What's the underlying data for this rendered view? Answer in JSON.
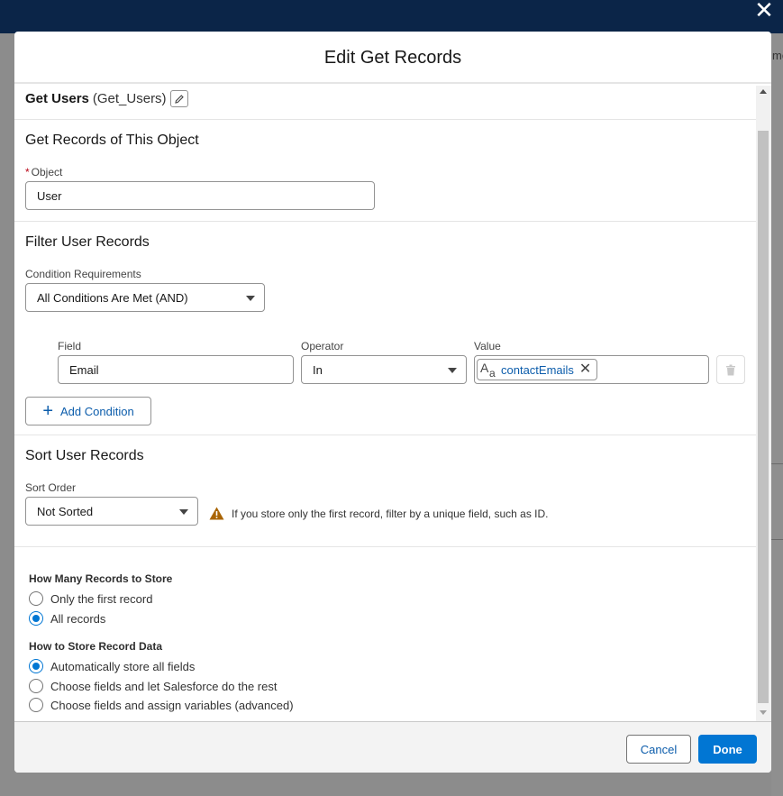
{
  "modal": {
    "title": "Edit Get Records",
    "element_label": "Get Users",
    "element_api_name": "(Get_Users)"
  },
  "background": {
    "partial_text": "me"
  },
  "object_section": {
    "title": "Get Records of This Object",
    "object_label": "Object",
    "required_mark": "*",
    "object_value": "User"
  },
  "filter_section": {
    "title": "Filter User Records",
    "condition_label": "Condition Requirements",
    "condition_value": "All Conditions Are Met (AND)",
    "columns": {
      "field": "Field",
      "operator": "Operator",
      "value": "Value"
    },
    "rows": [
      {
        "field": "Email",
        "operator": "In",
        "value": "contactEmails"
      }
    ],
    "add_condition": "Add Condition"
  },
  "sort_section": {
    "title": "Sort User Records",
    "sort_order_label": "Sort Order",
    "sort_order_value": "Not Sorted",
    "warning": "If you store only the first record, filter by a unique field, such as ID."
  },
  "store_section": {
    "how_many_title": "How Many Records to Store",
    "how_many_options": [
      {
        "label": "Only the first record",
        "selected": false
      },
      {
        "label": "All records",
        "selected": true
      }
    ],
    "how_to_title": "How to Store Record Data",
    "how_to_options": [
      {
        "label": "Automatically store all fields",
        "selected": true
      },
      {
        "label": "Choose fields and let Salesforce do the rest",
        "selected": false
      },
      {
        "label": "Choose fields and assign variables (advanced)",
        "selected": false
      }
    ]
  },
  "footer": {
    "cancel": "Cancel",
    "done": "Done"
  },
  "colors": {
    "brand": "#0176d3",
    "link": "#0b5cab",
    "header": "#0b2548",
    "warning": "#a96404"
  },
  "icons": [
    "close-icon",
    "edit-pencil-icon",
    "caret-down-icon",
    "text-resource-icon",
    "remove-icon",
    "trash-icon",
    "plus-icon",
    "warning-icon"
  ]
}
